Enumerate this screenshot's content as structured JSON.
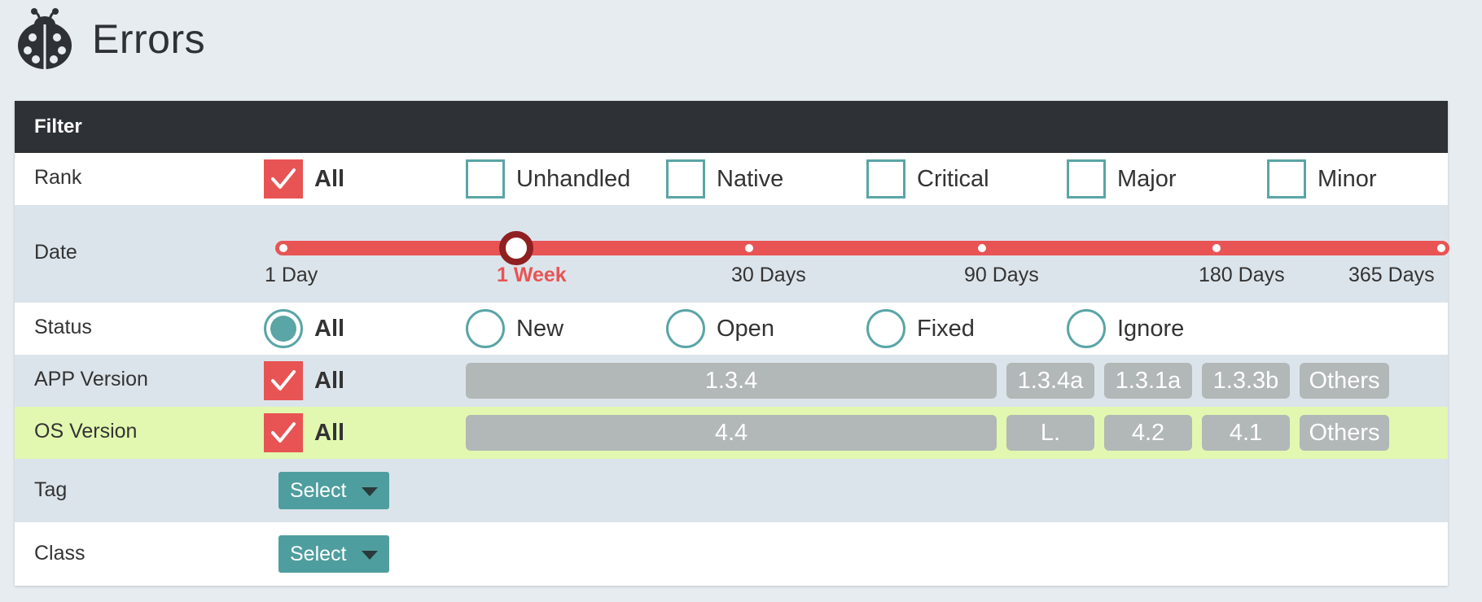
{
  "page": {
    "title": "Errors"
  },
  "filter": {
    "title": "Filter",
    "rank": {
      "label": "Rank",
      "options": [
        {
          "label": "All",
          "checked": true
        },
        {
          "label": "Unhandled",
          "checked": false
        },
        {
          "label": "Native",
          "checked": false
        },
        {
          "label": "Critical",
          "checked": false
        },
        {
          "label": "Major",
          "checked": false
        },
        {
          "label": "Minor",
          "checked": false
        }
      ]
    },
    "date": {
      "label": "Date",
      "steps": [
        "1 Day",
        "1 Week",
        "30 Days",
        "90 Days",
        "180 Days",
        "365 Days"
      ],
      "selected": "1 Week"
    },
    "status": {
      "label": "Status",
      "options": [
        {
          "label": "All",
          "selected": true
        },
        {
          "label": "New",
          "selected": false
        },
        {
          "label": "Open",
          "selected": false
        },
        {
          "label": "Fixed",
          "selected": false
        },
        {
          "label": "Ignore",
          "selected": false
        }
      ]
    },
    "app_version": {
      "label": "APP Version",
      "all_label": "All",
      "all_checked": true,
      "versions": [
        "1.3.4",
        "1.3.4a",
        "1.3.1a",
        "1.3.3b",
        "Others"
      ]
    },
    "os_version": {
      "label": "OS Version",
      "all_label": "All",
      "all_checked": true,
      "versions": [
        "4.4",
        "L.",
        "4.2",
        "4.1",
        "Others"
      ]
    },
    "tag": {
      "label": "Tag",
      "select_label": "Select"
    },
    "class": {
      "label": "Class",
      "select_label": "Select"
    }
  },
  "colors": {
    "accent_red": "#e85454",
    "teal": "#5aa5a6",
    "header_dark": "#2e3236",
    "highlight_green": "#e2f8b0",
    "pill_gray": "#b2b7b7"
  },
  "icons": {
    "page": "ladybug-icon",
    "check": "checkmark-icon",
    "dropdown": "caret-down-icon"
  }
}
